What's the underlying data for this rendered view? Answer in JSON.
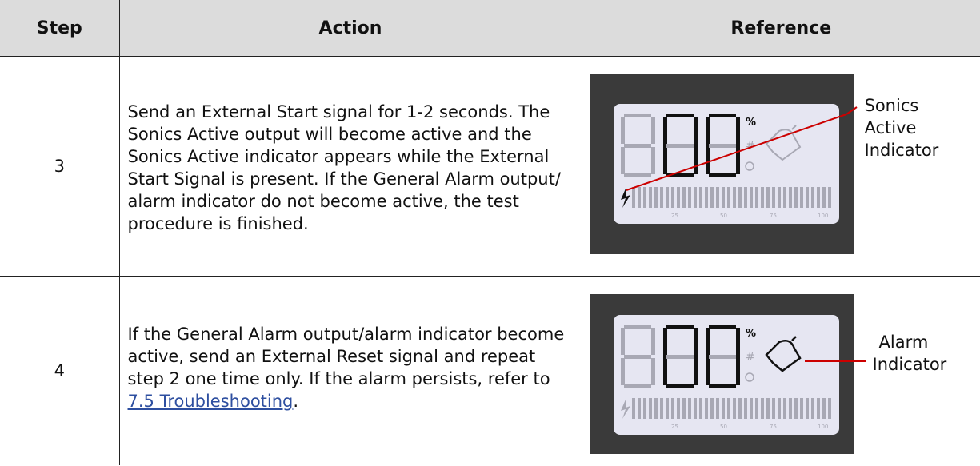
{
  "table": {
    "headers": {
      "step": "Step",
      "action": "Action",
      "reference": "Reference"
    },
    "rows": [
      {
        "step": "3",
        "action": "Send an External Start signal for 1-2 seconds. The Sonics Active output will become active and the Sonics Active indicator appears while the External Start Signal is present. If the General Alarm output/ alarm indicator do not become active, the test procedure is finished.",
        "reference": {
          "label_line1": "Sonics",
          "label_line2": "Active",
          "label_line3": "Indicator",
          "display": {
            "percent_sign": "%",
            "hash_sign": "#",
            "scale": [
              "25",
              "50",
              "75",
              "100"
            ]
          }
        }
      },
      {
        "step": "4",
        "action_prefix": "If the General Alarm output/alarm indicator become active, send an External Reset signal and repeat step 2 one time only. If the alarm persists, refer to ",
        "action_link": "7.5 Troubleshooting",
        "action_suffix": ".",
        "reference": {
          "label_line1": "Alarm",
          "label_line2": "Indicator",
          "display": {
            "percent_sign": "%",
            "hash_sign": "#",
            "scale": [
              "25",
              "50",
              "75",
              "100"
            ]
          }
        }
      }
    ]
  },
  "colors": {
    "header_bg": "#dcdcdc",
    "panel_bezel": "#3a3a3a",
    "lcd_bg": "#e6e6f2",
    "segment_on": "#111111",
    "segment_off": "#a8a8b4",
    "pointer_line": "#cc0000",
    "link": "#2e4fa0"
  }
}
